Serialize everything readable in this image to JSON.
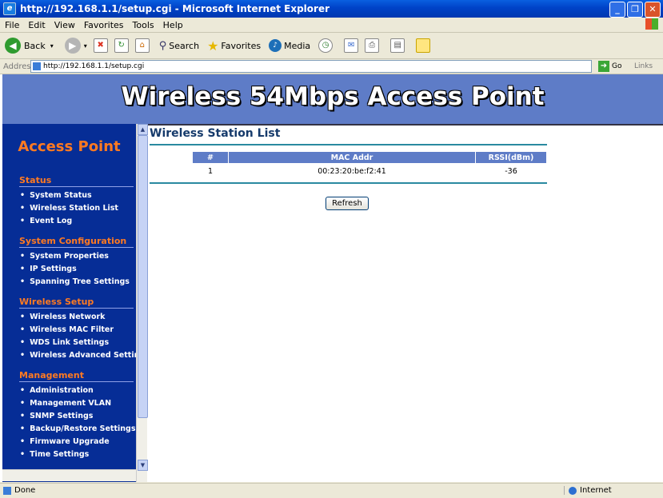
{
  "window": {
    "title": "http://192.168.1.1/setup.cgi - Microsoft Internet Explorer",
    "controls": [
      "_",
      "❐",
      "✕"
    ]
  },
  "menu": [
    "File",
    "Edit",
    "View",
    "Favorites",
    "Tools",
    "Help"
  ],
  "toolbar": {
    "back_label": "Back",
    "search_label": "Search",
    "favorites_label": "Favorites",
    "media_label": "Media"
  },
  "address": {
    "label": "Address",
    "url": "http://192.168.1.1/setup.cgi",
    "go_label": "Go",
    "links_label": "Links"
  },
  "banner": {
    "title": "Wireless 54Mbps Access Point"
  },
  "sidebar": {
    "heading": "Access Point",
    "sections": [
      {
        "title": "Status",
        "items": [
          "System Status",
          "Wireless Station List",
          "Event Log"
        ]
      },
      {
        "title": "System Configuration",
        "items": [
          "System Properties",
          "IP Settings",
          "Spanning Tree Settings"
        ]
      },
      {
        "title": "Wireless Setup",
        "items": [
          "Wireless Network",
          "Wireless MAC Filter",
          "WDS Link Settings",
          "Wireless Advanced Settings"
        ]
      },
      {
        "title": "Management",
        "items": [
          "Administration",
          "Management VLAN",
          "SNMP Settings",
          "Backup/Restore Settings",
          "Firmware Upgrade",
          "Time Settings"
        ]
      }
    ]
  },
  "main": {
    "title": "Wireless Station List",
    "table": {
      "headers": [
        "#",
        "MAC Addr",
        "RSSI(dBm)"
      ],
      "rows": [
        [
          "1",
          "00:23:20:be:f2:41",
          "-36"
        ]
      ]
    },
    "refresh_label": "Refresh"
  },
  "status": {
    "text": "Done",
    "zone": "Internet"
  },
  "colors": {
    "banner": "#5e7cc7",
    "sidebar": "#062d96",
    "section_title": "#ff7a21",
    "rule": "#2a8aa0"
  }
}
